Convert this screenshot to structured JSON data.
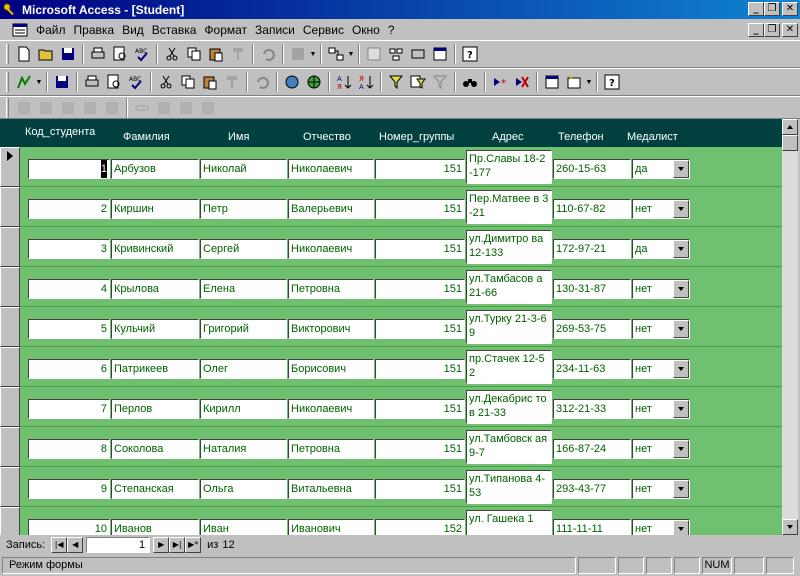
{
  "window": {
    "title": "Microsoft Access - [Student]"
  },
  "menu": {
    "items": [
      "Файл",
      "Правка",
      "Вид",
      "Вставка",
      "Формат",
      "Записи",
      "Сервис",
      "Окно",
      "?"
    ]
  },
  "form": {
    "headers": {
      "id": "Код_студента",
      "lastname": "Фамилия",
      "firstname": "Имя",
      "patronymic": "Отчество",
      "group": "Номер_группы",
      "address": "Адрес",
      "phone": "Телефон",
      "medal": "Медалист"
    },
    "records": [
      {
        "id": "1",
        "lastname": "Арбузов",
        "firstname": "Николай",
        "patronymic": "Николаевич",
        "group": "151",
        "address": "Пр.Славы 18-2-177",
        "phone": "260-15-63",
        "medal": "да"
      },
      {
        "id": "2",
        "lastname": "Киршин",
        "firstname": "Петр",
        "patronymic": "Валерьевич",
        "group": "151",
        "address": "Пер.Матвее в 3-21",
        "phone": "110-67-82",
        "medal": "нет"
      },
      {
        "id": "3",
        "lastname": "Кривинский",
        "firstname": "Сергей",
        "patronymic": "Николаевич",
        "group": "151",
        "address": "ул.Димитро ва 12-133",
        "phone": "172-97-21",
        "medal": "да"
      },
      {
        "id": "4",
        "lastname": "Крылова",
        "firstname": "Елена",
        "patronymic": "Петровна",
        "group": "151",
        "address": "ул.Тамбасов а 21-66",
        "phone": "130-31-87",
        "medal": "нет"
      },
      {
        "id": "5",
        "lastname": "Кульчий",
        "firstname": "Григорий",
        "patronymic": "Викторович",
        "group": "151",
        "address": "ул.Турку 21-3-69",
        "phone": "269-53-75",
        "medal": "нет"
      },
      {
        "id": "6",
        "lastname": "Патрикеев",
        "firstname": "Олег",
        "patronymic": "Борисович",
        "group": "151",
        "address": "пр.Стачек 12-52",
        "phone": "234-11-63",
        "medal": "нет"
      },
      {
        "id": "7",
        "lastname": "Перлов",
        "firstname": "Кирилл",
        "patronymic": "Николаевич",
        "group": "151",
        "address": "ул.Декабрис тов 21-33",
        "phone": "312-21-33",
        "medal": "нет"
      },
      {
        "id": "8",
        "lastname": "Соколова",
        "firstname": "Наталия",
        "patronymic": "Петровна",
        "group": "151",
        "address": "ул.Тамбовск ая 9-7",
        "phone": "166-87-24",
        "medal": "нет"
      },
      {
        "id": "9",
        "lastname": "Степанская",
        "firstname": "Ольга",
        "patronymic": "Витальевна",
        "group": "151",
        "address": "ул.Типанова 4-53",
        "phone": "293-43-77",
        "medal": "нет"
      },
      {
        "id": "10",
        "lastname": "Иванов",
        "firstname": "Иван",
        "patronymic": "Иванович",
        "group": "152",
        "address": "ул. Гашека 1",
        "phone": "111-11-11",
        "medal": "нет"
      }
    ]
  },
  "navigation": {
    "label": "Запись:",
    "current": "1",
    "of_label": "из",
    "total": "12"
  },
  "status": {
    "mode": "Режим формы",
    "num": "NUM"
  }
}
